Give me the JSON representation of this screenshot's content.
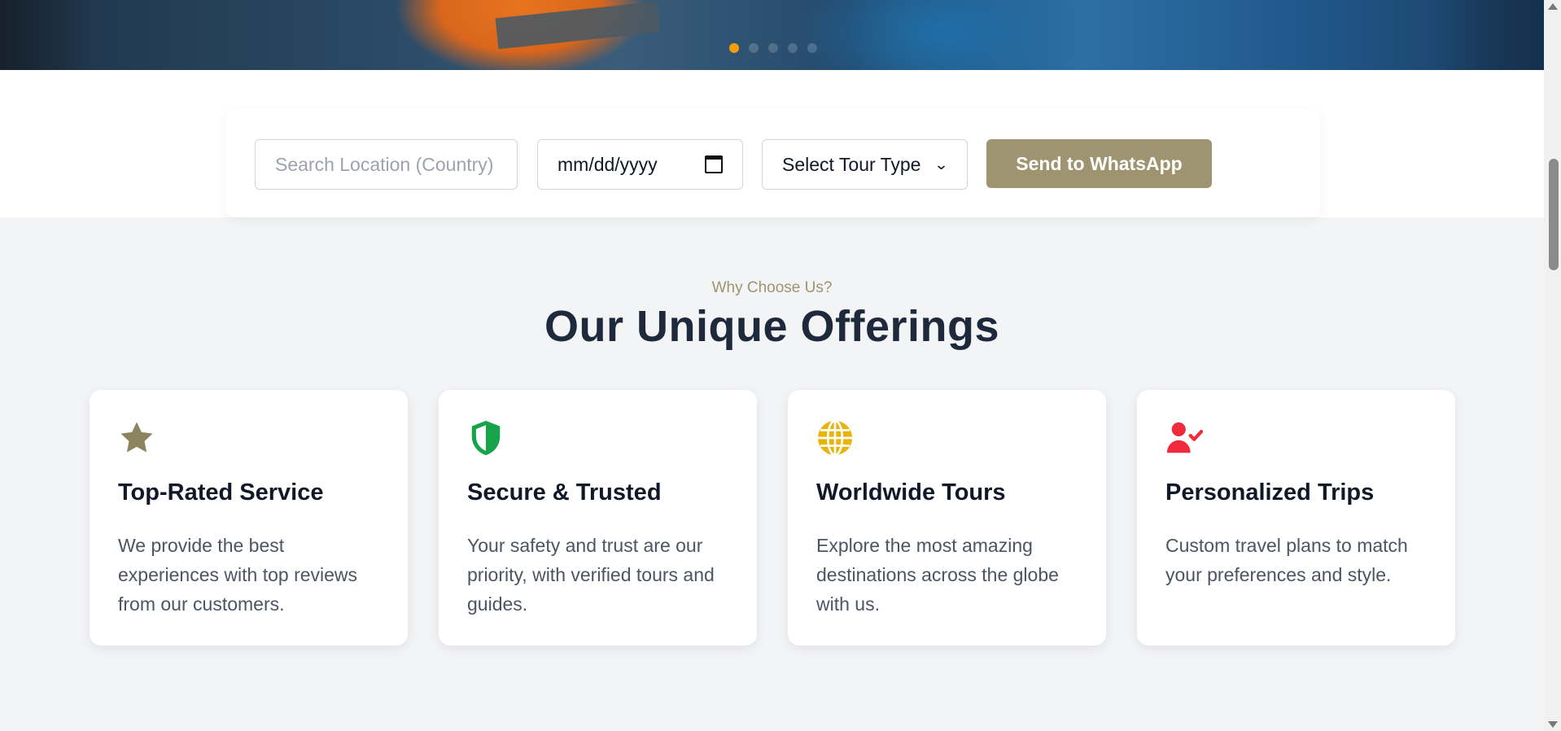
{
  "hero": {
    "slides": [
      {
        "active": true
      },
      {
        "active": false
      },
      {
        "active": false
      },
      {
        "active": false
      },
      {
        "active": false
      }
    ]
  },
  "search": {
    "location_placeholder": "Search Location (Country)",
    "date_placeholder": "mm/dd/yyyy",
    "tour_type_value": "Select Tour Type",
    "send_label": "Send to WhatsApp"
  },
  "section": {
    "eyebrow": "Why Choose Us?",
    "title": "Our Unique Offerings"
  },
  "cards": [
    {
      "icon": "star-icon",
      "color": "#8b845f",
      "title": "Top-Rated Service",
      "text": "We provide the best experiences with top reviews from our customers."
    },
    {
      "icon": "shield-icon",
      "color": "#16a34a",
      "title": "Secure & Trusted",
      "text": "Your safety and trust are our priority, with verified tours and guides."
    },
    {
      "icon": "globe-icon",
      "color": "#eab308",
      "title": "Worldwide Tours",
      "text": "Explore the most amazing destinations across the globe with us."
    },
    {
      "icon": "user-check-icon",
      "color": "#ef2b3c",
      "title": "Personalized Trips",
      "text": "Custom travel plans to match your preferences and style."
    }
  ],
  "colors": {
    "accent": "#9e946f",
    "dot_active": "#f59e0b",
    "heading": "#1e293b"
  }
}
